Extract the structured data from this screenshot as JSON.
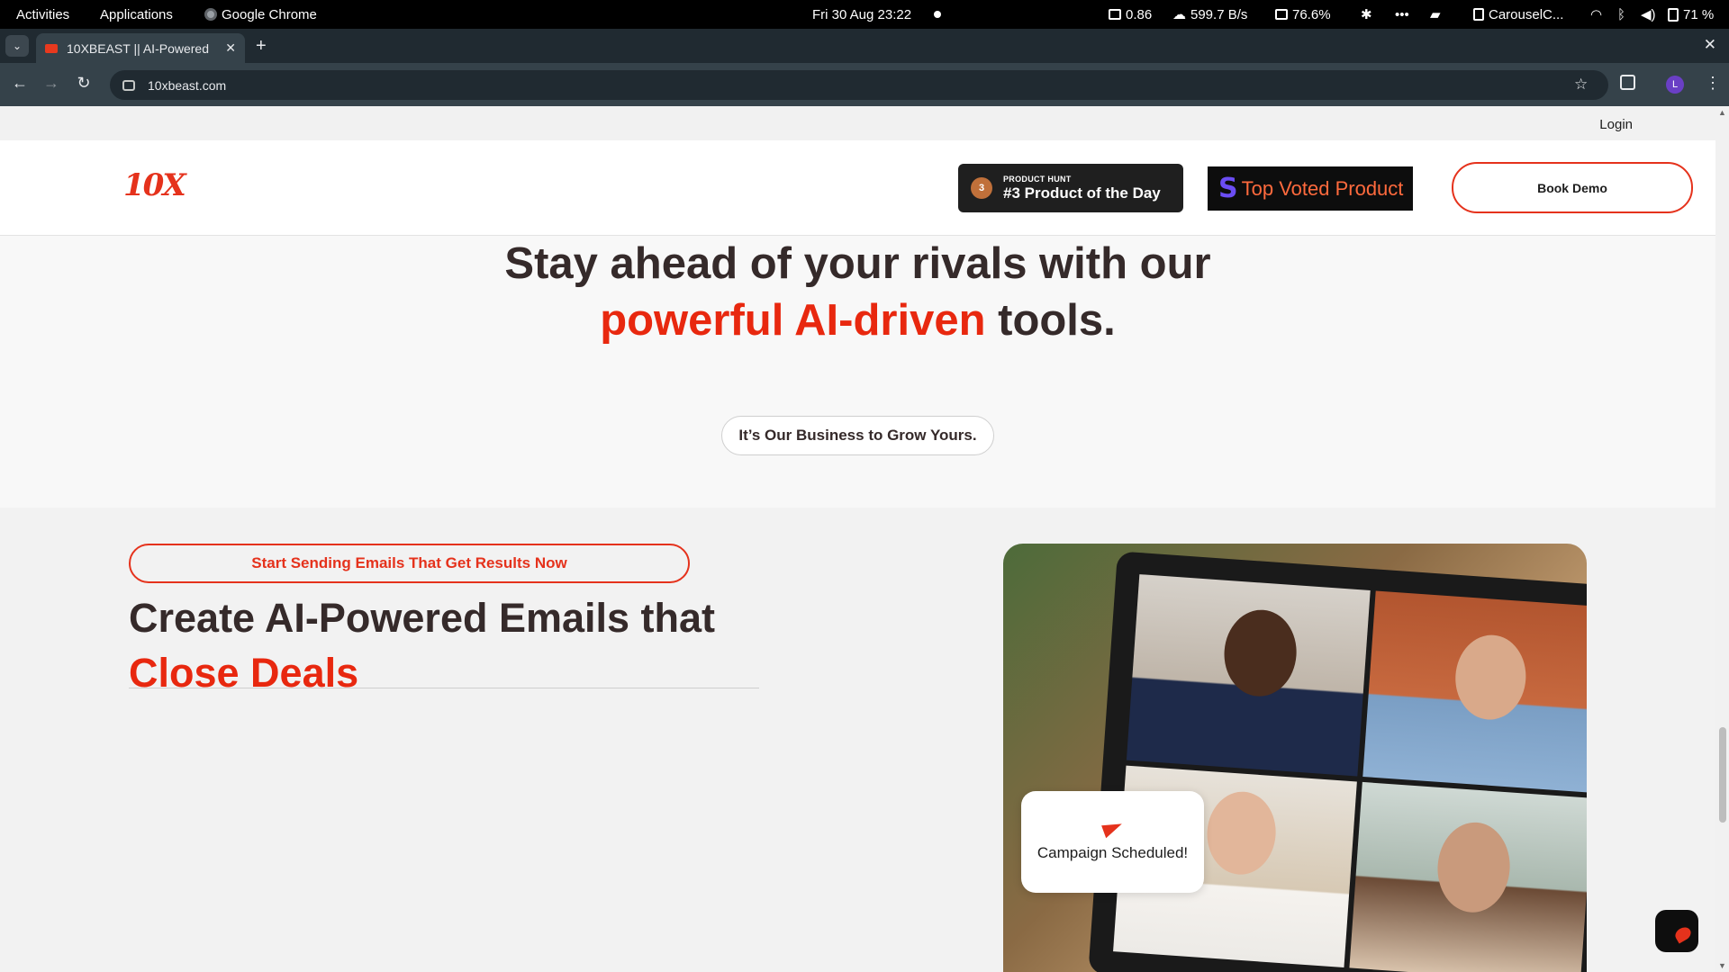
{
  "topbar": {
    "activities": "Activities",
    "applications": "Applications",
    "app_name": "Google Chrome",
    "datetime": "Fri 30 Aug  23:22",
    "cpu_load": "0.86",
    "net_speed": "599.7 B/s",
    "memory": "76.6%",
    "window_indicator": "CarouselC...",
    "battery": "71 %"
  },
  "browser": {
    "tab_title": "10XBEAST || AI-Powered",
    "url": "10xbeast.com",
    "avatar_letter": "L"
  },
  "site": {
    "login": "Login",
    "logo": "10X",
    "product_hunt_label": "PRODUCT HUNT",
    "product_hunt_title": "#3 Product of the Day",
    "medal_number": "3",
    "top_voted_mark": "S",
    "top_voted": "Top Voted Product",
    "book_demo": "Book Demo"
  },
  "hero": {
    "line1": "Stay ahead of your rivals with our",
    "highlight": "powerful AI-driven",
    "line2_tail": " tools.",
    "tagline": "It’s Our Business to Grow Yours."
  },
  "section": {
    "cta": "Start Sending Emails That Get Results Now",
    "heading_line1": "Create AI-Powered Emails that",
    "heading_highlight": "Close Deals",
    "toast": "Campaign Scheduled!"
  },
  "colors": {
    "brand_red": "#e5321c",
    "heading_dark": "#352a2a"
  }
}
